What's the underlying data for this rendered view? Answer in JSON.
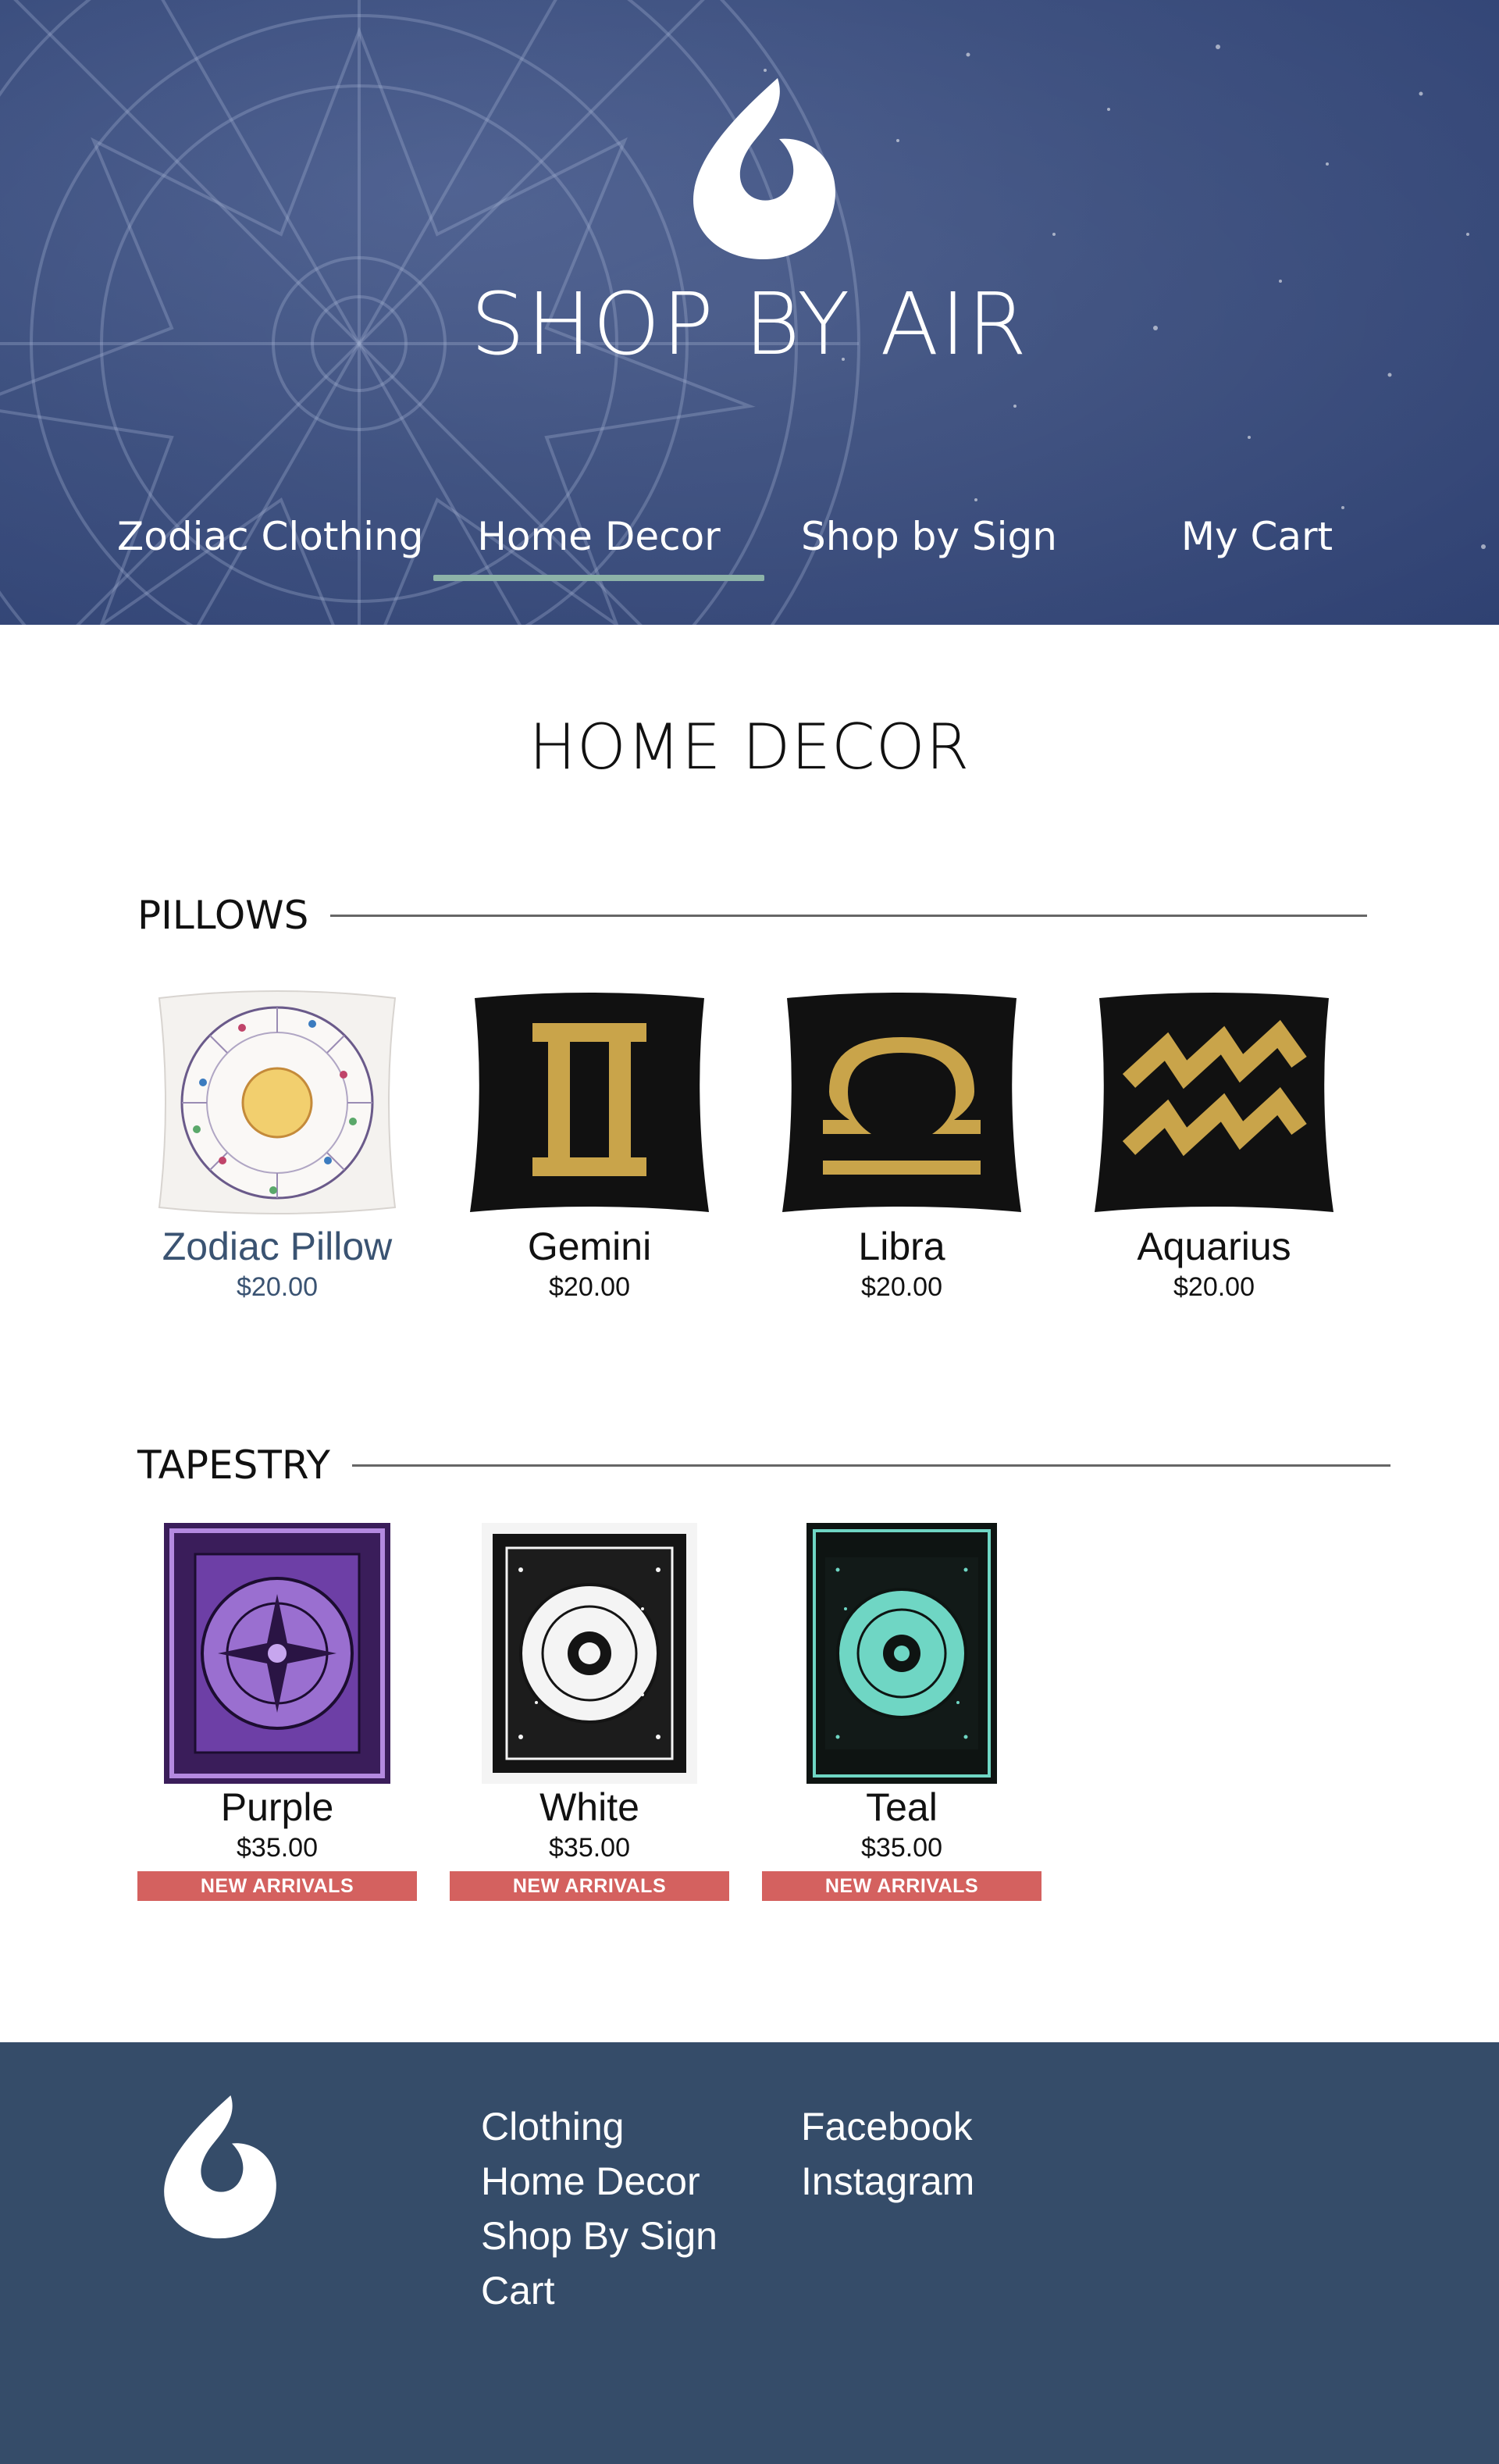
{
  "header": {
    "brand": "SHOP BY AIR",
    "logo_icon": "air-swirl-logo-icon"
  },
  "nav": {
    "items": [
      {
        "label": "Zodiac Clothing"
      },
      {
        "label": "Home Decor",
        "active": true
      },
      {
        "label": "Shop by Sign"
      },
      {
        "label": "My Cart"
      }
    ],
    "active_underline_color": "#8db3a8"
  },
  "main": {
    "title": "HOME DECOR",
    "pillows": {
      "heading": "PILLOWS",
      "items": [
        {
          "name": "Zodiac Pillow",
          "price": "$20.00",
          "icon": "zodiac-wheel-pillow-icon"
        },
        {
          "name": "Gemini",
          "price": "$20.00",
          "icon": "gemini-symbol-icon"
        },
        {
          "name": "Libra",
          "price": "$20.00",
          "icon": "libra-symbol-icon"
        },
        {
          "name": "Aquarius",
          "price": "$20.00",
          "icon": "aquarius-symbol-icon"
        }
      ]
    },
    "tapestry": {
      "heading": "TAPESTRY",
      "items": [
        {
          "name": "Purple",
          "price": "$35.00",
          "badge": "NEW ARRIVALS",
          "color": "#8a5bc4"
        },
        {
          "name": "White",
          "price": "$35.00",
          "badge": "NEW ARRIVALS",
          "color": "#ffffff"
        },
        {
          "name": "Teal",
          "price": "$35.00",
          "badge": "NEW ARRIVALS",
          "color": "#6fd6c4"
        }
      ]
    }
  },
  "footer": {
    "shop_links": [
      "Clothing",
      "Home Decor",
      "Shop By Sign",
      "Cart"
    ],
    "social_links": [
      "Facebook",
      "Instagram"
    ]
  },
  "colors": {
    "header_bg": "#3b4e7e",
    "footer_bg": "#354c69",
    "badge_bg": "#d4615f",
    "active_product": "#3a5372",
    "gold": "#c9a44a"
  }
}
